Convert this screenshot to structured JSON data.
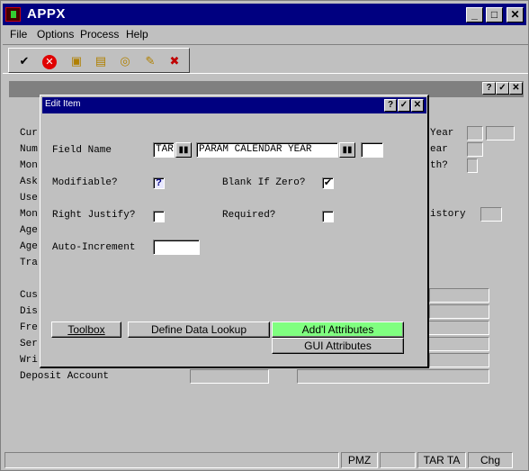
{
  "window": {
    "title": "APPX"
  },
  "menu": [
    "File",
    "Options",
    "Process",
    "Help"
  ],
  "toolbar": {
    "icons": [
      "ok-icon",
      "cancel-icon",
      "new-icon",
      "open-icon",
      "find-icon",
      "edit-icon",
      "delete-icon"
    ]
  },
  "background_labels": {
    "left": [
      "Cur",
      "Num",
      "Mon",
      "Ask",
      "Use",
      "Mon",
      "Age",
      "Age",
      "Tra",
      "Cus",
      "Dis",
      "Fre",
      "Ser",
      "Wri"
    ],
    "deposit": "Deposit Account",
    "right": [
      "Year",
      "ear",
      "th?",
      "istory"
    ]
  },
  "dialog": {
    "title": "Edit Item",
    "field_name_label": "Field Name",
    "field_name_prefix": "TAR",
    "field_name_value": "PARAM CALENDAR YEAR",
    "field_name_extra": "",
    "modifiable_label": "Modifiable?",
    "modifiable_value": "?",
    "blank_if_zero_label": "Blank If Zero?",
    "blank_if_zero_value": "✔",
    "right_justify_label": "Right Justify?",
    "right_justify_value": "",
    "required_label": "Required?",
    "required_value": "",
    "auto_increment_label": "Auto-Increment",
    "auto_increment_value": "",
    "buttons": {
      "toolbox": "Toolbox",
      "define_data_lookup": "Define Data Lookup",
      "addl_attributes": "Add'l Attributes",
      "gui_attributes": "GUI Attributes"
    },
    "active_color": "#80ff80"
  },
  "status": {
    "s1": "",
    "s2": "PMZ",
    "s3": "",
    "s4": "TAR TA",
    "s5": "Chg"
  }
}
